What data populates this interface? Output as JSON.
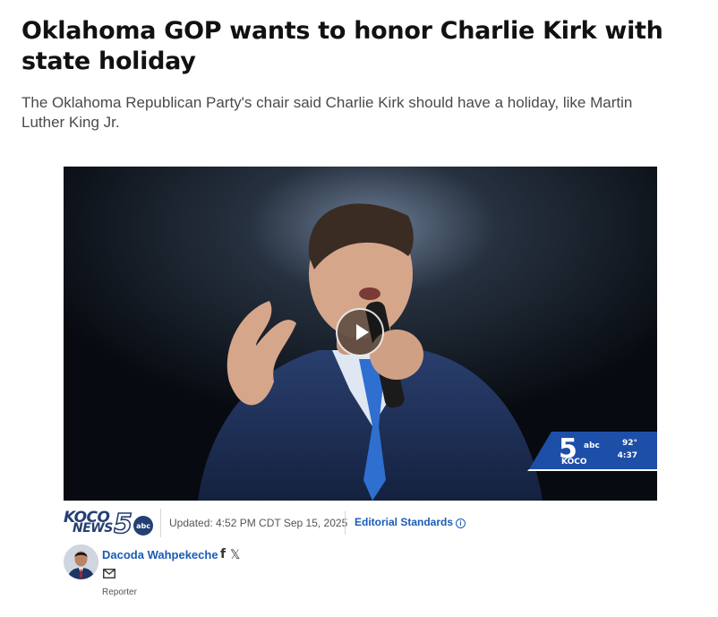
{
  "article": {
    "headline": "Oklahoma GOP wants to honor Charlie Kirk with state holiday",
    "dek": "The Oklahoma Republican Party's chair said Charlie Kirk should have a holiday, like Martin Luther King Jr."
  },
  "video": {
    "bug": {
      "channel_number": "5",
      "network": "abc",
      "station": "KOCO",
      "temperature": "92°",
      "time": "4:37"
    }
  },
  "meta": {
    "logo": {
      "line1": "KOCO",
      "line2": "NEWS",
      "number": "5",
      "network": "abc"
    },
    "updated": "Updated: 4:52 PM CDT Sep 15, 2025",
    "editorial_standards": "Editorial Standards",
    "info_glyph": "i"
  },
  "author": {
    "name": "Dacoda Wahpekeche",
    "facebook_glyph": "f",
    "x_glyph": "𝕏",
    "role": "Reporter"
  },
  "colors": {
    "link_blue": "#1a5bb8",
    "logo_navy": "#243f73",
    "bug_blue": "#1e4fa8"
  }
}
